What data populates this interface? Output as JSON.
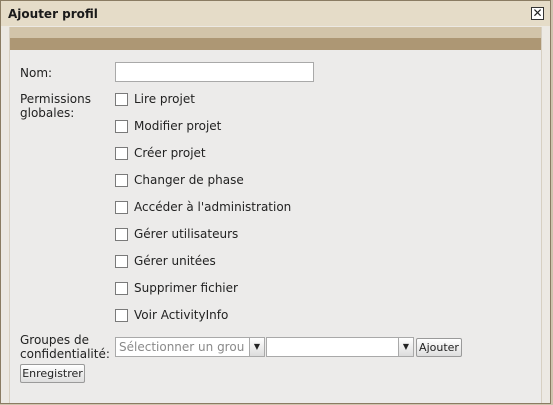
{
  "dialog": {
    "title": "Ajouter profil",
    "close_symbol": "✕"
  },
  "form": {
    "nom_label": "Nom:",
    "nom_value": "",
    "permissions_label_line1": "Permissions",
    "permissions_label_line2": "globales:",
    "permissions": [
      {
        "label": "Lire projet",
        "checked": false
      },
      {
        "label": "Modifier projet",
        "checked": false
      },
      {
        "label": "Créer projet",
        "checked": false
      },
      {
        "label": "Changer de phase",
        "checked": false
      },
      {
        "label": "Accéder à l'administration",
        "checked": false
      },
      {
        "label": "Gérer utilisateurs",
        "checked": false
      },
      {
        "label": "Gérer unitées",
        "checked": false
      },
      {
        "label": "Supprimer fichier",
        "checked": false
      },
      {
        "label": "Voir ActivityInfo",
        "checked": false
      }
    ],
    "groups_label_line1": "Groupes de",
    "groups_label_line2": "confidentialité:",
    "group_select_placeholder": "Sélectionner un groupe",
    "second_select_value": "",
    "add_button": "Ajouter",
    "save_button": "Enregistrer"
  }
}
